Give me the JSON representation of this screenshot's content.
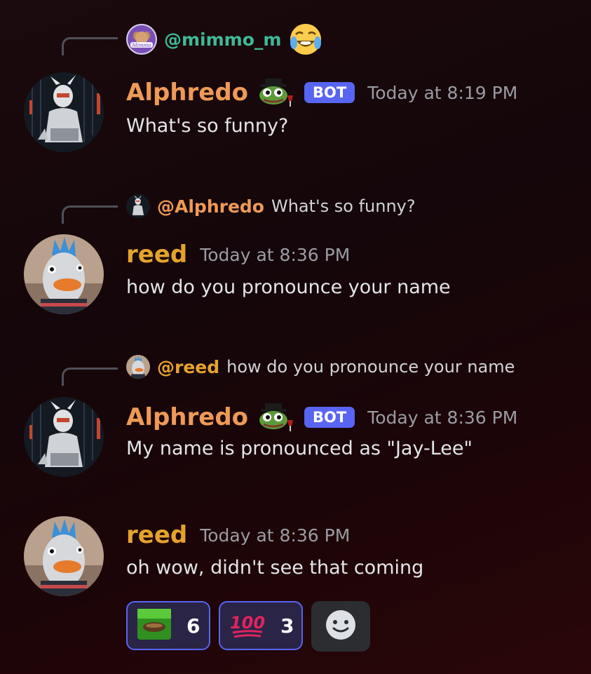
{
  "messages": [
    {
      "reply": {
        "user": "@mimmo_m",
        "text": "",
        "avatar_icon": "mimmo-avatar",
        "trailing_emoji": "joy-emoji"
      },
      "author": "Alphredo",
      "bot_tag": "BOT",
      "time": "Today at 8:19 PM",
      "text": "What's so funny?"
    },
    {
      "reply": {
        "user": "@Alphredo",
        "text": "What's so funny?",
        "avatar_icon": "alphredo-avatar"
      },
      "author": "reed",
      "time": "Today at 8:36 PM",
      "text": "how do you pronounce your name"
    },
    {
      "reply": {
        "user": "@reed",
        "text": "how do you pronounce your name",
        "avatar_icon": "reed-avatar"
      },
      "author": "Alphredo",
      "bot_tag": "BOT",
      "time": "Today at 8:36 PM",
      "text": "My name is pronounced as \"Jay-Lee\""
    },
    {
      "author": "reed",
      "time": "Today at 8:36 PM",
      "text": "oh wow, didn't see that coming"
    }
  ],
  "reactions": [
    {
      "emoji": "green-frog-emoji",
      "count": "6"
    },
    {
      "emoji": "hundred-emoji",
      "count": "3"
    }
  ],
  "add_reaction_icon": "add-reaction-icon",
  "colors": {
    "alphredo_name": "#ee9a57",
    "reed_name": "#e5a32c",
    "mimmo_name": "#3fb996",
    "bot_tag": "#5865f2",
    "reaction_border": "#5865f2"
  }
}
